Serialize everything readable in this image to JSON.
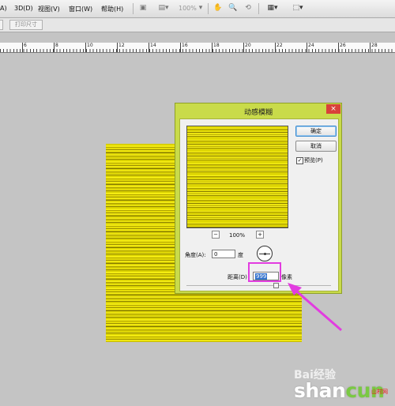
{
  "menubar": {
    "items": [
      "A)",
      "3D(D)",
      "视图(V)",
      "窗口(W)",
      "帮助(H)"
    ],
    "zoom": "100%"
  },
  "options_bar": {
    "print_size": "打印尺寸"
  },
  "ruler": {
    "labels": [
      "6",
      "8",
      "10",
      "12",
      "14",
      "16",
      "18",
      "20",
      "22",
      "24",
      "26",
      "28"
    ]
  },
  "dialog": {
    "title": "动感模糊",
    "close": "×",
    "ok": "确定",
    "cancel": "取消",
    "preview_label": "预览(P)",
    "preview_checked": "✓",
    "zoom_minus": "−",
    "zoom_plus": "+",
    "zoom_value": "100%",
    "angle_label": "角度(A):",
    "angle_value": "0",
    "angle_unit": "度",
    "distance_label": "距离(D)",
    "distance_value": "999",
    "distance_unit": "像素"
  },
  "watermark": {
    "baidu": "Bai经验",
    "shancun_a": "shan",
    "shancun_b": "cun",
    "net": "山村网"
  },
  "colors": {
    "dialog_frame": "#c9db4a",
    "highlight": "#e23ce0",
    "image_yellow": "#e6dc08"
  }
}
